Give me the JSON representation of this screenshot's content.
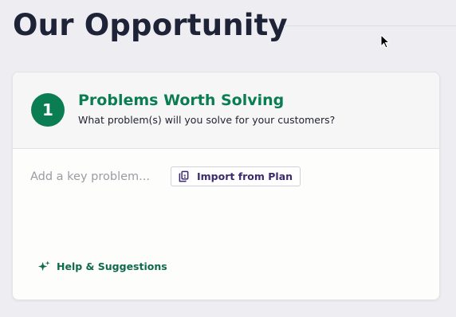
{
  "page": {
    "title": "Our Opportunity"
  },
  "section": {
    "number": "1",
    "title": "Problems Worth Solving",
    "subtitle": "What problem(s) will you solve for your customers?"
  },
  "problem_input": {
    "placeholder": "Add a key problem...",
    "value": ""
  },
  "import_button": {
    "label": "Import from Plan",
    "icon": "copy-document-icon"
  },
  "help_link": {
    "label": "Help & Suggestions",
    "icon": "sparkle-icon"
  },
  "colors": {
    "accent_green": "#0b7d52",
    "title_navy": "#1f2338",
    "button_text_purple": "#3c2a6e",
    "background": "#eeeef2"
  }
}
